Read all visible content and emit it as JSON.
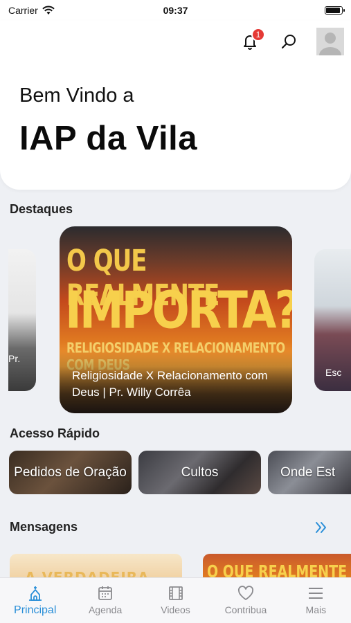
{
  "status_bar": {
    "carrier": "Carrier",
    "time": "09:37"
  },
  "header": {
    "notification_count": "1",
    "welcome": "Bem Vindo a",
    "church_name": "IAP da Vila"
  },
  "highlights": {
    "title": "Destaques",
    "main_card": {
      "line1": "O QUE REALMENTE",
      "line2": "IMPORTA?",
      "line3": "RELIGIOSIDADE X RELACIONAMENTO COM DEUS",
      "caption": "Religiosidade X Relacionamento com Deus | Pr. Willy Corrêa"
    },
    "left_card_text": "Pr.",
    "right_card_text": "Esc"
  },
  "quick_access": {
    "title": "Acesso Rápido",
    "items": [
      {
        "label": "Pedidos de Oração"
      },
      {
        "label": "Cultos"
      },
      {
        "label": "Onde Est"
      }
    ]
  },
  "messages": {
    "title": "Mensagens",
    "thumb1_text": "A VERDADEIRA",
    "thumb2_text": "O QUE REALMENTE"
  },
  "tabbar": {
    "items": [
      {
        "label": "Principal",
        "icon": "church-icon",
        "active": true
      },
      {
        "label": "Agenda",
        "icon": "calendar-icon"
      },
      {
        "label": "Videos",
        "icon": "film-icon"
      },
      {
        "label": "Contribua",
        "icon": "heart-icon"
      },
      {
        "label": "Mais",
        "icon": "menu-icon"
      }
    ]
  },
  "colors": {
    "accent": "#2a8fd8",
    "badge": "#e53935",
    "background": "#eef0f4"
  }
}
